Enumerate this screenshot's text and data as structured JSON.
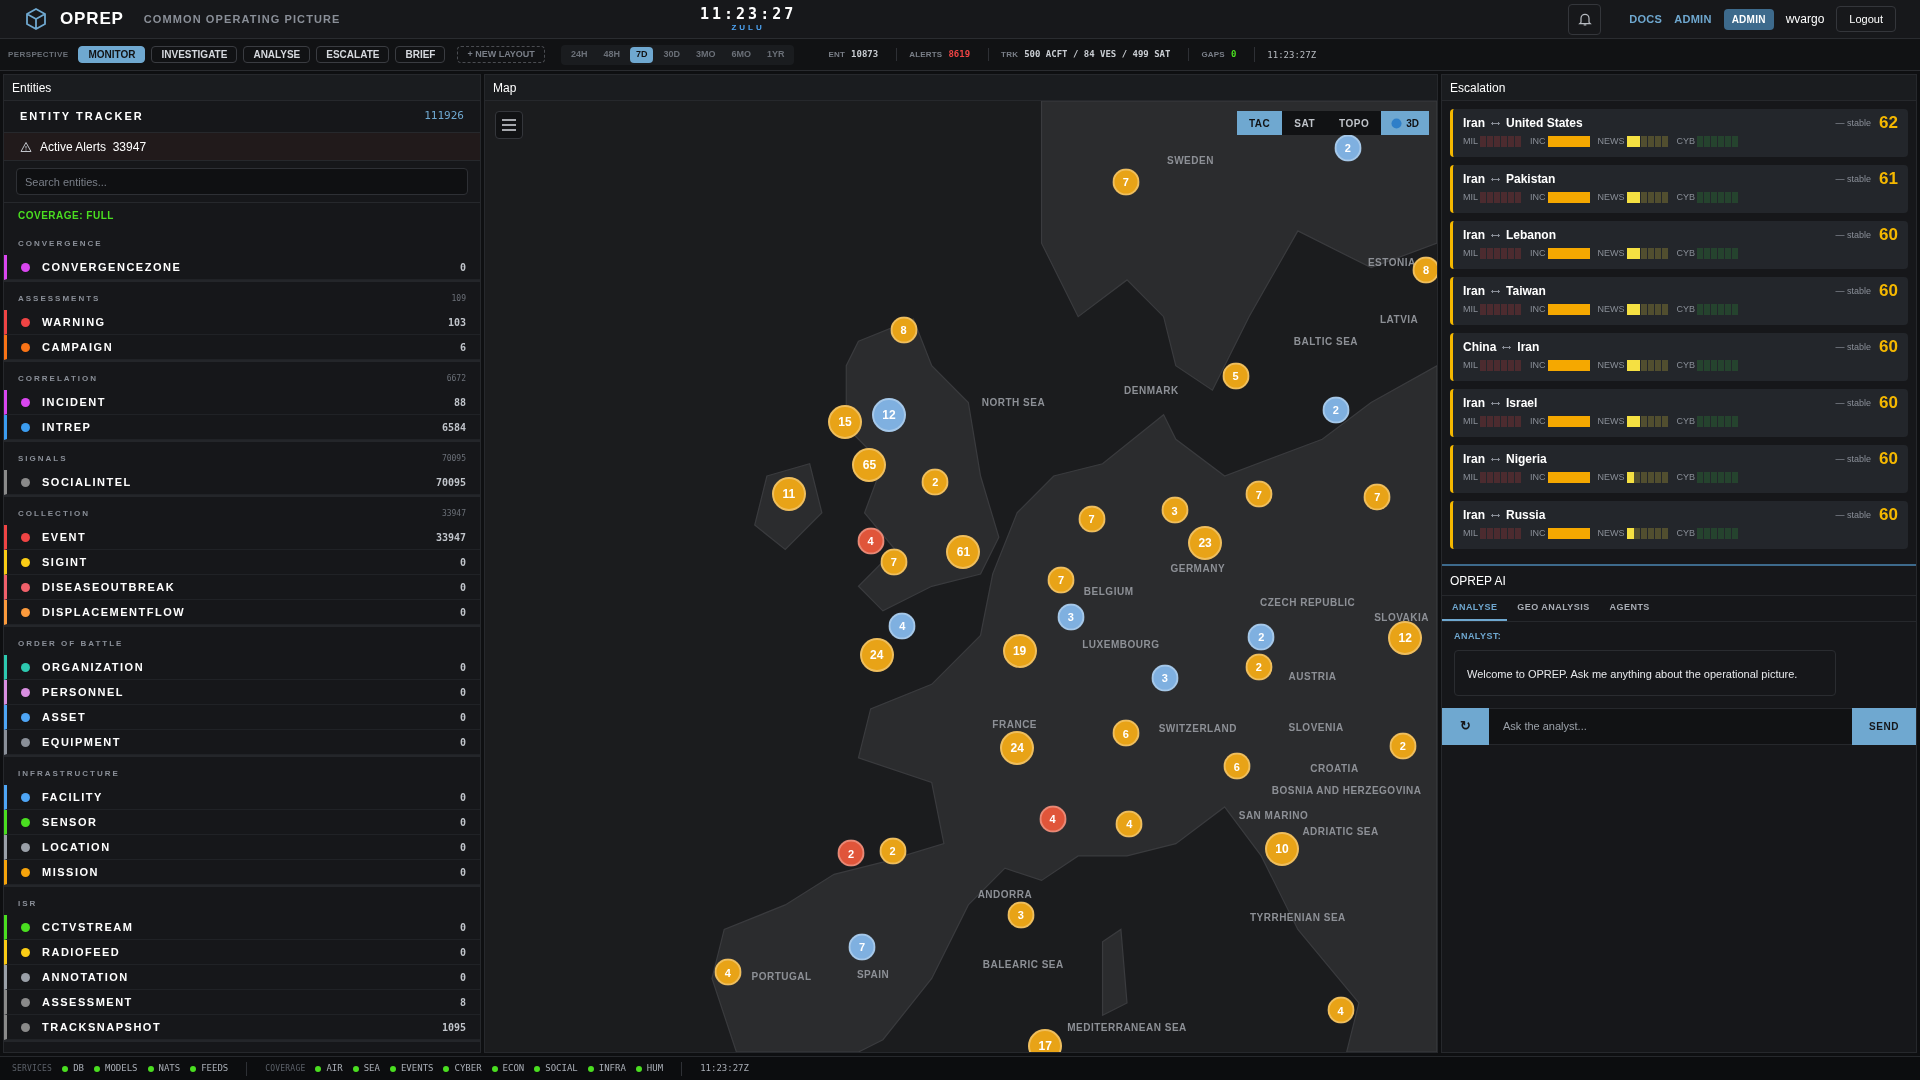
{
  "header": {
    "logo_text": "OPREP",
    "subtitle": "COMMON OPERATING PICTURE",
    "clock": "11:23:27",
    "clock_zone": "ZULU",
    "links": [
      "DOCS",
      "ADMIN"
    ],
    "role_badge": "ADMIN",
    "user": "wvargo",
    "logout": "Logout"
  },
  "toolbar": {
    "perspective_label": "PERSPECTIVE",
    "perspectives": [
      {
        "label": "MONITOR",
        "selected": true
      },
      {
        "label": "INVESTIGATE",
        "selected": false
      },
      {
        "label": "ANALYSE",
        "selected": false
      },
      {
        "label": "ESCALATE",
        "selected": false
      },
      {
        "label": "BRIEF",
        "selected": false
      }
    ],
    "new_layout": "+ NEW LAYOUT",
    "ranges": [
      {
        "label": "24H",
        "selected": false
      },
      {
        "label": "48H",
        "selected": false
      },
      {
        "label": "7D",
        "selected": true
      },
      {
        "label": "30D",
        "selected": false
      },
      {
        "label": "3MO",
        "selected": false
      },
      {
        "label": "6MO",
        "selected": false
      },
      {
        "label": "1YR",
        "selected": false
      }
    ],
    "stats": [
      {
        "label": "ENT",
        "value": "10873",
        "color": "#c9cdd2"
      },
      {
        "label": "ALERTS",
        "value": "8619",
        "color": "#ef4444"
      },
      {
        "label": "TRK",
        "value": "500 ACFT / 84 VES / 499 SAT",
        "color": "#c9cdd2"
      },
      {
        "label": "GAPS",
        "value": "0",
        "color": "#4ade20"
      }
    ],
    "time": "11:23:27Z"
  },
  "entities": {
    "title": "Entities",
    "tracker_label": "ENTITY TRACKER",
    "tracker_count": "111926",
    "alerts_label": "Active Alerts",
    "alerts_count": "33947",
    "search_placeholder": "Search entities...",
    "coverage": "COVERAGE: FULL",
    "sections": [
      {
        "name": "CONVERGENCE",
        "items": [
          {
            "label": "CONVERGENCEZONE",
            "count": "0",
            "color": "#d946ef"
          }
        ]
      },
      {
        "name": "ASSESSMENTS",
        "total": "109",
        "items": [
          {
            "label": "WARNING",
            "count": "103",
            "color": "#ef4444"
          },
          {
            "label": "CAMPAIGN",
            "count": "6",
            "color": "#f97316"
          }
        ]
      },
      {
        "name": "CORRELATION",
        "total": "6672",
        "items": [
          {
            "label": "INCIDENT",
            "count": "88",
            "color": "#d946ef"
          },
          {
            "label": "INTREP",
            "count": "6584",
            "color": "#3b9cf0"
          }
        ]
      },
      {
        "name": "SIGNALS",
        "total": "70095",
        "items": [
          {
            "label": "SOCIALINTEL",
            "count": "70095",
            "color": "#8a8a8a"
          }
        ]
      },
      {
        "name": "COLLECTION",
        "total": "33947",
        "items": [
          {
            "label": "EVENT",
            "count": "33947",
            "color": "#ef4444"
          },
          {
            "label": "SIGINT",
            "count": "0",
            "color": "#facc15"
          },
          {
            "label": "DISEASEOUTBREAK",
            "count": "0",
            "color": "#f0606a"
          },
          {
            "label": "DISPLACEMENTFLOW",
            "count": "0",
            "color": "#fb9a3c"
          }
        ]
      },
      {
        "name": "ORDER OF BATTLE",
        "items": [
          {
            "label": "ORGANIZATION",
            "count": "0",
            "color": "#2dc9b0"
          },
          {
            "label": "PERSONNEL",
            "count": "0",
            "color": "#d88ee0"
          },
          {
            "label": "ASSET",
            "count": "0",
            "color": "#4ea5f5"
          },
          {
            "label": "EQUIPMENT",
            "count": "0",
            "color": "#8a8f98"
          }
        ]
      },
      {
        "name": "INFRASTRUCTURE",
        "items": [
          {
            "label": "FACILITY",
            "count": "0",
            "color": "#4ea5f5"
          },
          {
            "label": "SENSOR",
            "count": "0",
            "color": "#4ade20"
          },
          {
            "label": "LOCATION",
            "count": "0",
            "color": "#9aa0a8"
          },
          {
            "label": "MISSION",
            "count": "0",
            "color": "#f5a30b"
          }
        ]
      },
      {
        "name": "ISR",
        "items": [
          {
            "label": "CCTVSTREAM",
            "count": "0",
            "color": "#4ade20"
          },
          {
            "label": "RADIOFEED",
            "count": "0",
            "color": "#facc15"
          },
          {
            "label": "ANNOTATION",
            "count": "0",
            "color": "#9aa0a8"
          },
          {
            "label": "ASSESSMENT",
            "count": "8",
            "color": "#8a8a8a"
          },
          {
            "label": "TRACKSNAPSHOT",
            "count": "1095",
            "color": "#8a8a8a"
          }
        ]
      }
    ]
  },
  "map": {
    "title": "Map",
    "layers": [
      {
        "label": "TAC",
        "selected": true
      },
      {
        "label": "SAT",
        "selected": false
      },
      {
        "label": "TOPO",
        "selected": false
      }
    ],
    "toggle_3d": {
      "label": "3D",
      "on": true
    },
    "places": [
      "SWEDEN",
      "ESTONIA",
      "LATVIA",
      "BALTIC SEA",
      "NORTH SEA",
      "DENMARK",
      "GERMANY",
      "BELGIUM",
      "LUXEMBOURG",
      "CZECH REPUBLIC",
      "SLOVAKIA",
      "AUSTRIA",
      "SWITZERLAND",
      "FRANCE",
      "SLOVENIA",
      "CROATIA",
      "BOSNIA AND HERZEGOVINA",
      "SAN MARINO",
      "ADRIATIC SEA",
      "ANDORRA",
      "SPAIN",
      "PORTUGAL",
      "BALEARIC SEA",
      "TYRRHENIAN SEA",
      "MEDITERRANEAN SEA"
    ],
    "clusters": [
      {
        "label": "7",
        "color": "#e8a317"
      },
      {
        "label": "2",
        "color": "#7fb0e0"
      },
      {
        "label": "8",
        "color": "#e8a317"
      },
      {
        "label": "8",
        "color": "#e8a317"
      },
      {
        "label": "12",
        "color": "#7fb0e0"
      },
      {
        "label": "15",
        "color": "#e8a317"
      },
      {
        "label": "65",
        "color": "#e8a317"
      },
      {
        "label": "11",
        "color": "#e8a317"
      },
      {
        "label": "2",
        "color": "#e8a317"
      },
      {
        "label": "5",
        "color": "#e8a317"
      },
      {
        "label": "2",
        "color": "#7fb0e0"
      },
      {
        "label": "7",
        "color": "#e8a317"
      },
      {
        "label": "7",
        "color": "#e8a317"
      },
      {
        "label": "3",
        "color": "#e8a317"
      },
      {
        "label": "7",
        "color": "#e8a317"
      },
      {
        "label": "4",
        "color": "#e0553a"
      },
      {
        "label": "7",
        "color": "#e8a317"
      },
      {
        "label": "61",
        "color": "#e8a317"
      },
      {
        "label": "23",
        "color": "#e8a317"
      },
      {
        "label": "7",
        "color": "#e8a317"
      },
      {
        "label": "3",
        "color": "#7fb0e0"
      },
      {
        "label": "4",
        "color": "#7fb0e0"
      },
      {
        "label": "24",
        "color": "#e8a317"
      },
      {
        "label": "19",
        "color": "#e8a317"
      },
      {
        "label": "2",
        "color": "#7fb0e0"
      },
      {
        "label": "2",
        "color": "#e8a317"
      },
      {
        "label": "3",
        "color": "#7fb0e0"
      },
      {
        "label": "12",
        "color": "#e8a317"
      },
      {
        "label": "6",
        "color": "#e8a317"
      },
      {
        "label": "24",
        "color": "#e8a317"
      },
      {
        "label": "6",
        "color": "#e8a317"
      },
      {
        "label": "2",
        "color": "#e8a317"
      },
      {
        "label": "4",
        "color": "#e0553a"
      },
      {
        "label": "4",
        "color": "#e8a317"
      },
      {
        "label": "2",
        "color": "#e0553a"
      },
      {
        "label": "2",
        "color": "#e8a317"
      },
      {
        "label": "10",
        "color": "#e8a317"
      },
      {
        "label": "3",
        "color": "#e8a317"
      },
      {
        "label": "7",
        "color": "#7fb0e0"
      },
      {
        "label": "4",
        "color": "#e8a317"
      },
      {
        "label": "4",
        "color": "#e8a317"
      },
      {
        "label": "17",
        "color": "#e8a317"
      }
    ]
  },
  "escalation": {
    "title": "Escalation",
    "items": [
      {
        "a": "Iran",
        "b": "United States",
        "trend": "— stable",
        "score": "62",
        "metrics": [
          {
            "label": "MIL",
            "level": 0
          },
          {
            "label": "INC",
            "level": 1
          },
          {
            "label": "NEWS",
            "level": 0.33
          },
          {
            "label": "CYB",
            "level": 0
          }
        ]
      },
      {
        "a": "Iran",
        "b": "Pakistan",
        "trend": "— stable",
        "score": "61",
        "metrics": [
          {
            "label": "MIL",
            "level": 0
          },
          {
            "label": "INC",
            "level": 1
          },
          {
            "label": "NEWS",
            "level": 0.33
          },
          {
            "label": "CYB",
            "level": 0
          }
        ]
      },
      {
        "a": "Iran",
        "b": "Lebanon",
        "trend": "— stable",
        "score": "60",
        "metrics": [
          {
            "label": "MIL",
            "level": 0
          },
          {
            "label": "INC",
            "level": 1
          },
          {
            "label": "NEWS",
            "level": 0.33
          },
          {
            "label": "CYB",
            "level": 0
          }
        ]
      },
      {
        "a": "Iran",
        "b": "Taiwan",
        "trend": "— stable",
        "score": "60",
        "metrics": [
          {
            "label": "MIL",
            "level": 0
          },
          {
            "label": "INC",
            "level": 1
          },
          {
            "label": "NEWS",
            "level": 0.33
          },
          {
            "label": "CYB",
            "level": 0
          }
        ]
      },
      {
        "a": "China",
        "b": "Iran",
        "trend": "— stable",
        "score": "60",
        "metrics": [
          {
            "label": "MIL",
            "level": 0
          },
          {
            "label": "INC",
            "level": 1
          },
          {
            "label": "NEWS",
            "level": 0.33
          },
          {
            "label": "CYB",
            "level": 0
          }
        ]
      },
      {
        "a": "Iran",
        "b": "Israel",
        "trend": "— stable",
        "score": "60",
        "metrics": [
          {
            "label": "MIL",
            "level": 0
          },
          {
            "label": "INC",
            "level": 1
          },
          {
            "label": "NEWS",
            "level": 0.33
          },
          {
            "label": "CYB",
            "level": 0
          }
        ]
      },
      {
        "a": "Iran",
        "b": "Nigeria",
        "trend": "— stable",
        "score": "60",
        "metrics": [
          {
            "label": "MIL",
            "level": 0
          },
          {
            "label": "INC",
            "level": 1
          },
          {
            "label": "NEWS",
            "level": 0.17
          },
          {
            "label": "CYB",
            "level": 0
          }
        ]
      },
      {
        "a": "Iran",
        "b": "Russia",
        "trend": "— stable",
        "score": "60",
        "metrics": [
          {
            "label": "MIL",
            "level": 0
          },
          {
            "label": "INC",
            "level": 1
          },
          {
            "label": "NEWS",
            "level": 0.17
          },
          {
            "label": "CYB",
            "level": 0
          }
        ]
      }
    ]
  },
  "ai": {
    "title": "OPREP AI",
    "tabs": [
      {
        "label": "ANALYSE",
        "selected": true
      },
      {
        "label": "GEO ANALYSIS",
        "selected": false
      },
      {
        "label": "AGENTS",
        "selected": false
      }
    ],
    "speaker": "ANALYST:",
    "message": "Welcome to OPREP. Ask me anything about the operational picture.",
    "reset_glyph": "↻",
    "input_placeholder": "Ask the analyst...",
    "send": "SEND"
  },
  "status_bar": {
    "services_label": "SERVICES",
    "services": [
      {
        "label": "DB",
        "ok": true
      },
      {
        "label": "MODELS",
        "ok": true
      },
      {
        "label": "NATS",
        "ok": true
      },
      {
        "label": "FEEDS",
        "ok": true
      }
    ],
    "coverage_label": "COVERAGE",
    "coverage": [
      {
        "label": "AIR",
        "ok": true
      },
      {
        "label": "SEA",
        "ok": true
      },
      {
        "label": "EVENTS",
        "ok": true
      },
      {
        "label": "CYBER",
        "ok": true
      },
      {
        "label": "ECON",
        "ok": true
      },
      {
        "label": "SOCIAL",
        "ok": true
      },
      {
        "label": "INFRA",
        "ok": true
      },
      {
        "label": "HUM",
        "ok": true
      }
    ],
    "time": "11:23:27Z"
  }
}
